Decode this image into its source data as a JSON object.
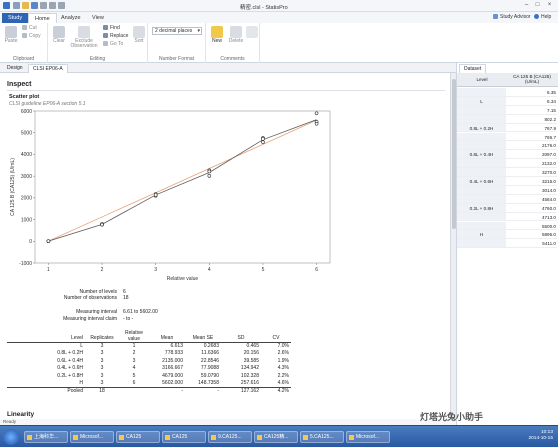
{
  "app": {
    "title": "精密.clsl - StatisPro"
  },
  "ribbon": {
    "tabs": [
      "Study",
      "Home",
      "Analyze",
      "View"
    ],
    "active_tab": "Home",
    "clipboard": {
      "paste": "Paste",
      "cut": "Cut",
      "copy": "Copy",
      "label": "Clipboard"
    },
    "editing": {
      "clear": "Clear",
      "exclude": "Exclude Observation",
      "find": "Find",
      "replace": "Replace",
      "goto": "Go To",
      "sort": "Sort",
      "label": "Editing"
    },
    "number_format": {
      "value": "2 decimal places",
      "label": "Number Format"
    },
    "comments": {
      "new": "New",
      "delete": "Delete",
      "label": "Comments"
    },
    "help": {
      "advisor": "Study Advisor",
      "help": "Help"
    }
  },
  "doc_tabs": [
    "Design",
    "CLSI EP06-A"
  ],
  "inspect": {
    "heading": "Inspect",
    "plot_title": "Scatter plot",
    "plot_subtitle": "CLSI guideline EP06-A section 5.1"
  },
  "chart_data": {
    "type": "scatter",
    "xlabel": "Relative value",
    "ylabel": "CA 125 B (CA125) (U/mL)",
    "xlim": [
      1,
      6
    ],
    "ylim": [
      -1000,
      6000
    ],
    "xticks": [
      "1",
      "2",
      "3",
      "4",
      "5",
      "6"
    ],
    "yticks": [
      "-1000",
      "0",
      "1000",
      "2000",
      "3000",
      "4000",
      "5000",
      "6000"
    ],
    "x_positions": [
      1,
      2,
      3,
      4,
      5,
      6
    ],
    "points": [
      {
        "x": 1,
        "y": 6.35
      },
      {
        "x": 1,
        "y": 6.34
      },
      {
        "x": 1,
        "y": 7.15
      },
      {
        "x": 2,
        "y": 802.2
      },
      {
        "x": 2,
        "y": 767.9
      },
      {
        "x": 2,
        "y": 766.7
      },
      {
        "x": 3,
        "y": 2176.0
      },
      {
        "x": 3,
        "y": 2097.0
      },
      {
        "x": 3,
        "y": 2132.0
      },
      {
        "x": 4,
        "y": 3270.0
      },
      {
        "x": 4,
        "y": 3216.0
      },
      {
        "x": 4,
        "y": 3014.0
      },
      {
        "x": 5,
        "y": 4564.0
      },
      {
        "x": 5,
        "y": 4760.0
      },
      {
        "x": 5,
        "y": 4713.0
      },
      {
        "x": 6,
        "y": 5500.0
      },
      {
        "x": 6,
        "y": 5895.0
      },
      {
        "x": 6,
        "y": 5411.0
      }
    ],
    "series": [
      {
        "name": "linear fit",
        "color": "#e8a07a",
        "values": [
          6.6,
          1121,
          2235,
          3350,
          4464,
          5579
        ]
      },
      {
        "name": "mean line",
        "color": "#5a5a5a",
        "values": [
          6.6,
          779,
          2135,
          3167,
          4679,
          5602
        ]
      }
    ]
  },
  "summary": {
    "levels_label": "Number of levels",
    "levels": "6",
    "obs_label": "Number of observations",
    "obs": "18",
    "interval_label": "Measuring interval",
    "interval": "6.61 to 5602.00",
    "claim_label": "Measuring interval claim",
    "claim": "- to -"
  },
  "results": {
    "headers": [
      "Level",
      "Replicates",
      "Relative value",
      "Mean",
      "Mean SE",
      "SD",
      "CV"
    ],
    "rows": [
      [
        "L",
        "3",
        "1",
        "6.613",
        "0.2683",
        "0.465",
        "7.0%"
      ],
      [
        "0.8L + 0.2H",
        "3",
        "2",
        "778.933",
        "11.6366",
        "20.156",
        "2.6%"
      ],
      [
        "0.6L + 0.4H",
        "3",
        "3",
        "2135.000",
        "22.8546",
        "39.585",
        "1.9%"
      ],
      [
        "0.4L + 0.6H",
        "3",
        "4",
        "3166.667",
        "77.9088",
        "134.942",
        "4.3%"
      ],
      [
        "0.2L + 0.8H",
        "3",
        "5",
        "4679.000",
        "59.0790",
        "102.328",
        "2.2%"
      ],
      [
        "H",
        "3",
        "6",
        "5602.000",
        "148.7358",
        "257.616",
        "4.6%"
      ]
    ],
    "pooled": [
      "Pooled",
      "18",
      "",
      "-",
      "-",
      "127.162",
      "4.2%"
    ]
  },
  "linearity_heading": "Linearity",
  "dataset": {
    "tab": "Dataset",
    "col_level": "Level",
    "col_value": "CA 125 B (CA125) (U/mL)",
    "rows": [
      {
        "level": "",
        "value": "6.35"
      },
      {
        "level": "L",
        "value": "6.34"
      },
      {
        "level": "",
        "value": "7.15"
      },
      {
        "level": "",
        "value": "802.2"
      },
      {
        "level": "0.8L + 0.2H",
        "value": "767.9"
      },
      {
        "level": "",
        "value": "766.7"
      },
      {
        "level": "",
        "value": "2176.0"
      },
      {
        "level": "0.6L + 0.4H",
        "value": "2097.0"
      },
      {
        "level": "",
        "value": "2132.0"
      },
      {
        "level": "",
        "value": "3270.0"
      },
      {
        "level": "0.4L + 0.6H",
        "value": "3216.0"
      },
      {
        "level": "",
        "value": "3014.0"
      },
      {
        "level": "",
        "value": "4564.0"
      },
      {
        "level": "0.2L + 0.8H",
        "value": "4760.0"
      },
      {
        "level": "",
        "value": "4713.0"
      },
      {
        "level": "",
        "value": "5500.0"
      },
      {
        "level": "H",
        "value": "5895.0"
      },
      {
        "level": "",
        "value": "5411.0"
      }
    ]
  },
  "status": "Ready",
  "taskbar": {
    "items": [
      "上海科华...",
      "Microsof...",
      "CA125",
      "CA125",
      "9.CA125...",
      "CA125精...",
      "5.CA125...",
      "Microsof..."
    ],
    "clock_time": "10:13",
    "clock_date": "2014-10-15"
  },
  "watermark": "灯塔光兔小助手",
  "colors": {
    "accent": "#2e64b5",
    "fit": "#e8a07a",
    "mean": "#5a5a5a"
  }
}
